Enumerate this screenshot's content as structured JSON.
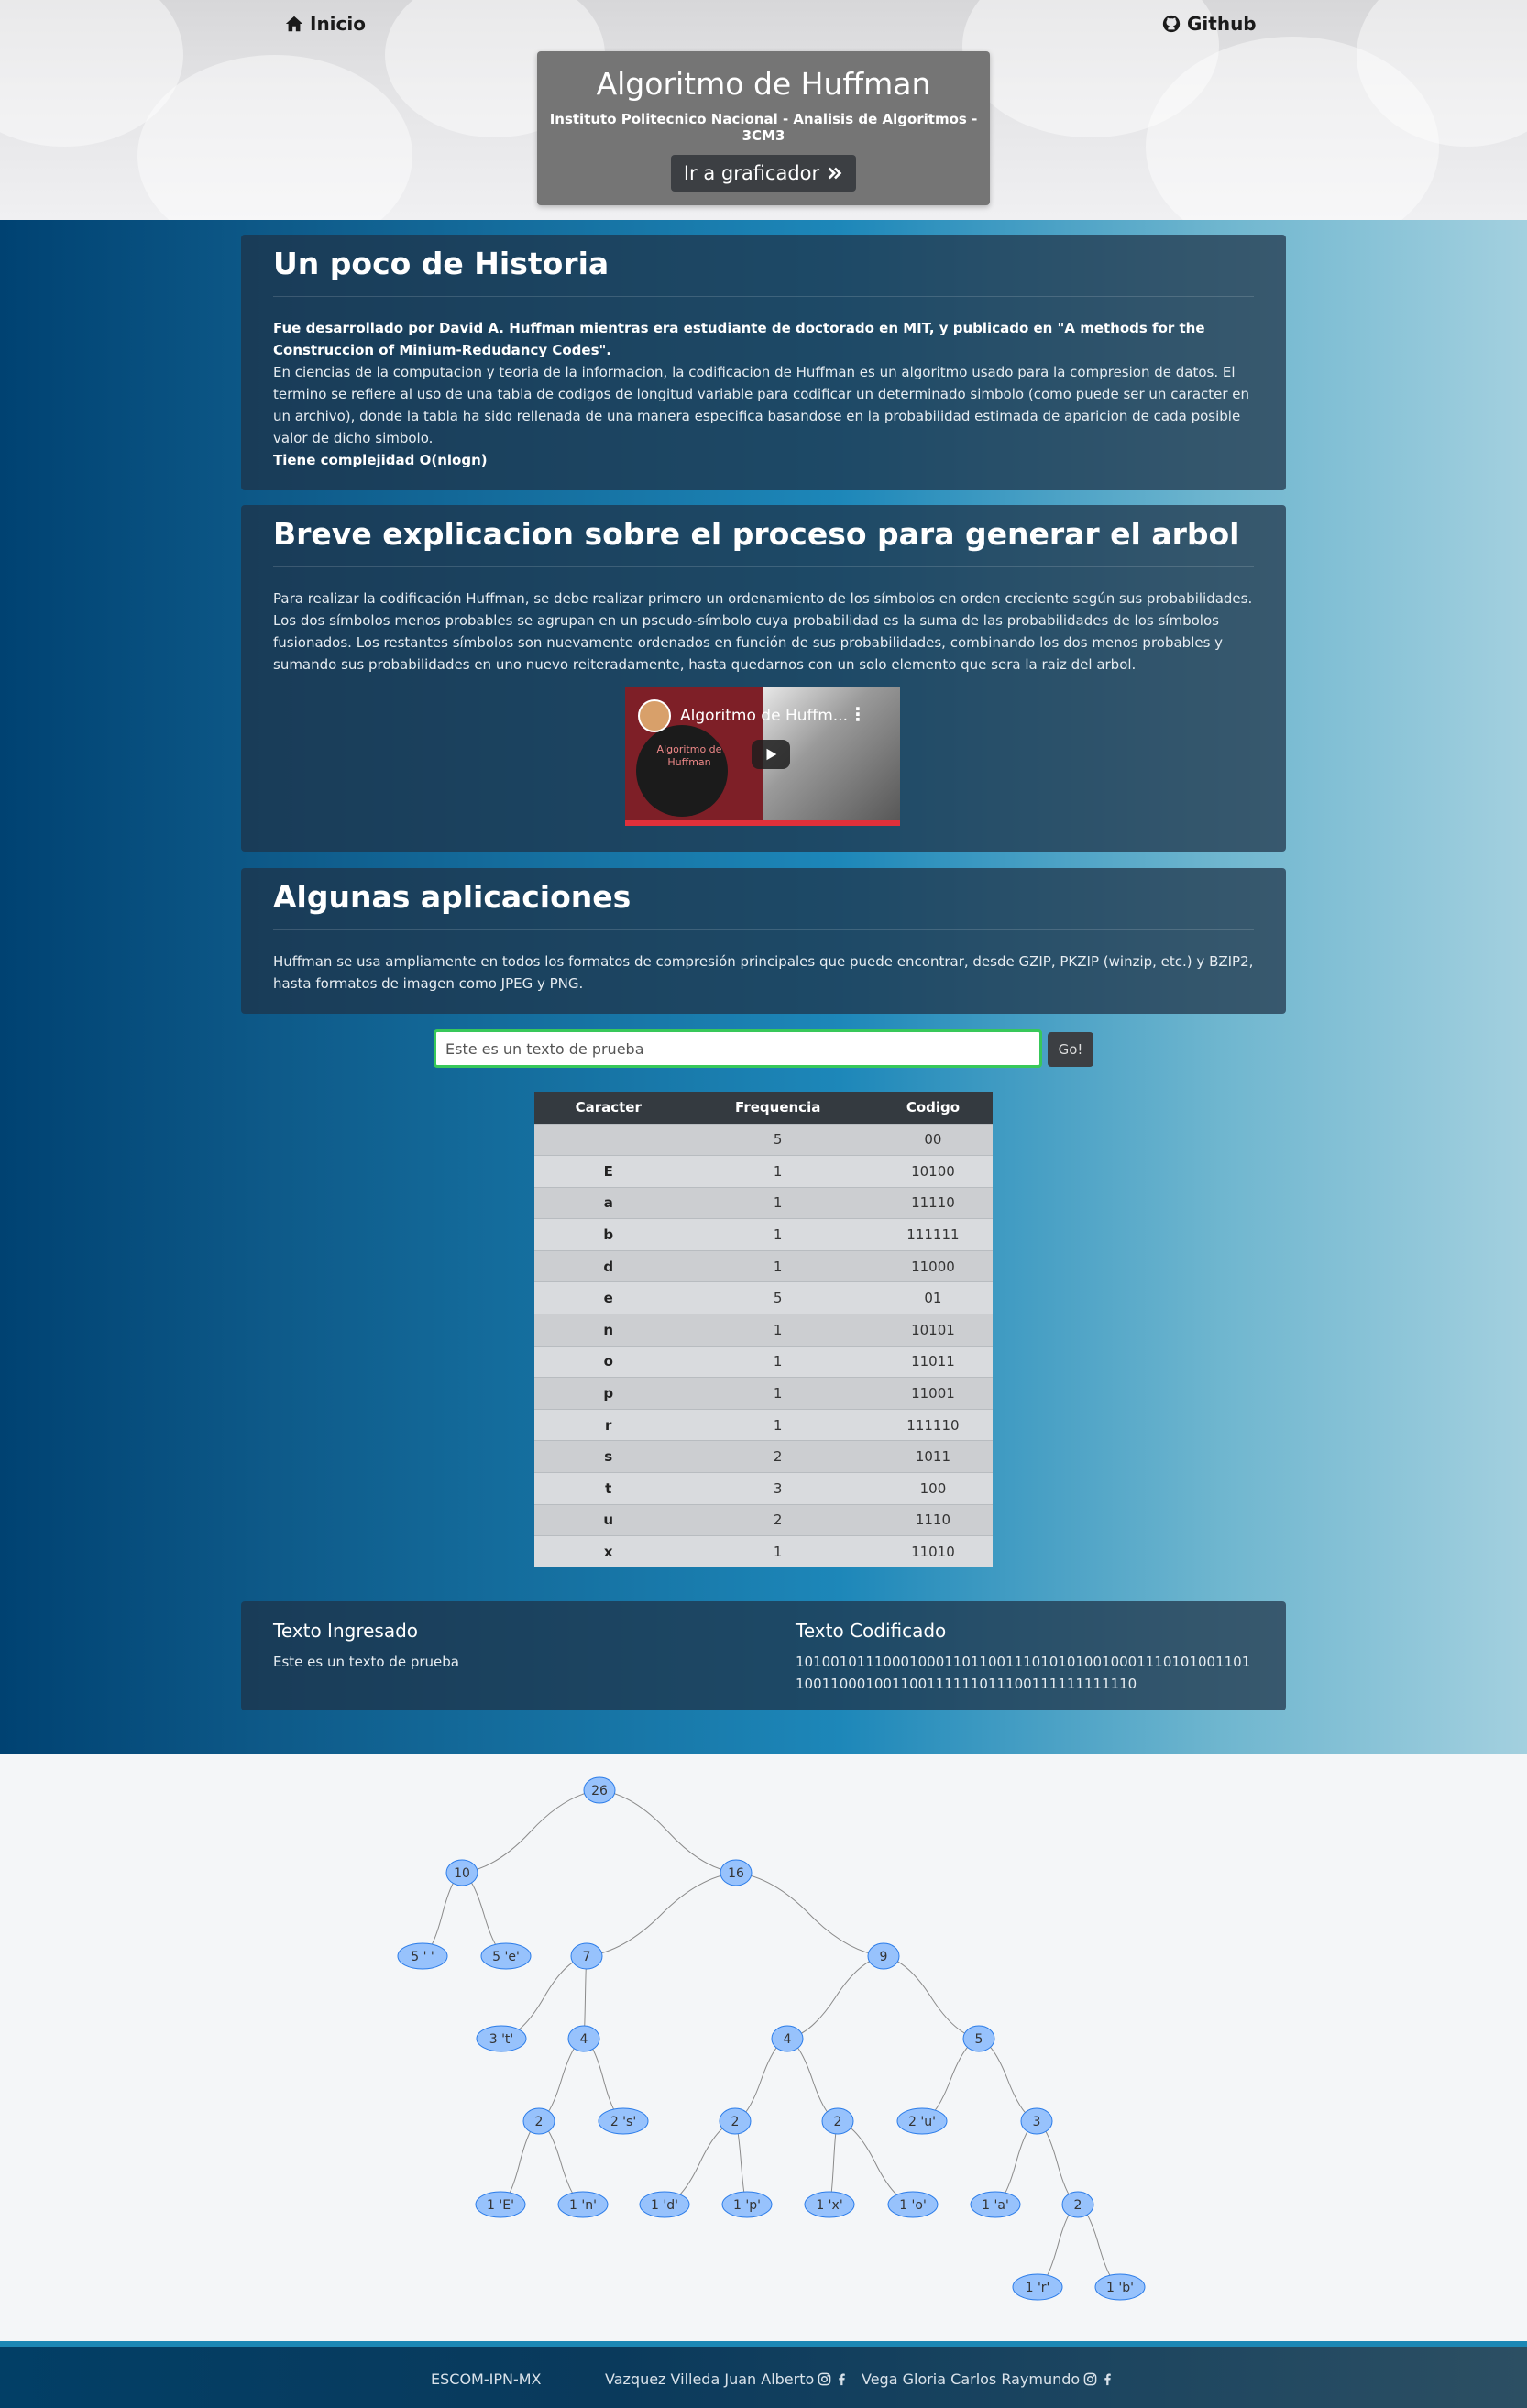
{
  "nav": {
    "home_label": "Inicio",
    "github_label": "Github"
  },
  "hero": {
    "title": "Algoritmo de Huffman",
    "subtitle": "Instituto Politecnico Nacional - Analisis de Algoritmos - 3CM3",
    "button_label": "Ir a graficador"
  },
  "history": {
    "heading": "Un poco de Historia",
    "bold_intro": "Fue desarrollado por David A. Huffman mientras era estudiante de doctorado en MIT, y publicado en \"A methods for the Construccion of Minium-Redudancy Codes\".",
    "body": "En ciencias de la computacion y teoria de la informacion, la codificacion de Huffman es un algoritmo usado para la compresion de datos. El termino se refiere al uso de una tabla de codigos de longitud variable para codificar un determinado simbolo (como puede ser un caracter en un archivo), donde la tabla ha sido rellenada de una manera especifica basandose en la probabilidad estimada de aparicion de cada posible valor de dicho simbolo.",
    "complexity": "Tiene complejidad O(nlogn)"
  },
  "process": {
    "heading": "Breve explicacion sobre el proceso para generar el arbol",
    "body": "Para realizar la codificación Huffman, se debe realizar primero un ordenamiento de los símbolos en orden creciente según sus probabilidades. Los dos símbolos menos probables se agrupan en un pseudo-símbolo cuya probabilidad es la suma de las probabilidades de los símbolos fusionados. Los restantes símbolos son nuevamente ordenados en función de sus probabilidades, combinando los dos menos probables y sumando sus probabilidades en uno nuevo reiteradamente, hasta quedarnos con un solo elemento que sera la raiz del arbol.",
    "video_title": "Algoritmo de Huffm...",
    "video_thumb_text": "Algoritmo de Huffman"
  },
  "applications": {
    "heading": "Algunas aplicaciones",
    "body": "Huffman se usa ampliamente en todos los formatos de compresión principales que puede encontrar, desde GZIP, PKZIP (winzip, etc.) y BZIP2, hasta formatos de imagen como JPEG y PNG."
  },
  "input": {
    "value": "Este es un texto de prueba",
    "go_label": "Go!"
  },
  "table": {
    "headers": [
      "Caracter",
      "Frequencia",
      "Codigo"
    ],
    "rows": [
      [
        " ",
        "5",
        "00"
      ],
      [
        "E",
        "1",
        "10100"
      ],
      [
        "a",
        "1",
        "11110"
      ],
      [
        "b",
        "1",
        "111111"
      ],
      [
        "d",
        "1",
        "11000"
      ],
      [
        "e",
        "5",
        "01"
      ],
      [
        "n",
        "1",
        "10101"
      ],
      [
        "o",
        "1",
        "11011"
      ],
      [
        "p",
        "1",
        "11001"
      ],
      [
        "r",
        "1",
        "111110"
      ],
      [
        "s",
        "2",
        "1011"
      ],
      [
        "t",
        "3",
        "100"
      ],
      [
        "u",
        "2",
        "1110"
      ],
      [
        "x",
        "1",
        "11010"
      ]
    ]
  },
  "result": {
    "input_heading": "Texto Ingresado",
    "input_text": "Este es un texto de prueba",
    "encoded_heading": "Texto Codificado",
    "encoded_text": "1010010111000100011011001110101010010001110101001101100110001001100111111011100111111111110"
  },
  "tree": {
    "nodes": [
      {
        "id": "n26",
        "label": "26"
      },
      {
        "id": "n10",
        "label": "10"
      },
      {
        "id": "n16",
        "label": "16"
      },
      {
        "id": "sp",
        "label": "5 ' '"
      },
      {
        "id": "e",
        "label": "5 'e'"
      },
      {
        "id": "n7",
        "label": "7"
      },
      {
        "id": "n9",
        "label": "9"
      },
      {
        "id": "t",
        "label": "3 't'"
      },
      {
        "id": "n4a",
        "label": "4"
      },
      {
        "id": "n4b",
        "label": "4"
      },
      {
        "id": "n5",
        "label": "5"
      },
      {
        "id": "n2a",
        "label": "2"
      },
      {
        "id": "s",
        "label": "2 's'"
      },
      {
        "id": "n2b",
        "label": "2"
      },
      {
        "id": "n2c",
        "label": "2"
      },
      {
        "id": "u",
        "label": "2 'u'"
      },
      {
        "id": "n3",
        "label": "3"
      },
      {
        "id": "E",
        "label": "1 'E'"
      },
      {
        "id": "n",
        "label": "1 'n'"
      },
      {
        "id": "d",
        "label": "1 'd'"
      },
      {
        "id": "p",
        "label": "1 'p'"
      },
      {
        "id": "x",
        "label": "1 'x'"
      },
      {
        "id": "o",
        "label": "1 'o'"
      },
      {
        "id": "a",
        "label": "1 'a'"
      },
      {
        "id": "n2d",
        "label": "2"
      },
      {
        "id": "r",
        "label": "1 'r'"
      },
      {
        "id": "b",
        "label": "1 'b'"
      }
    ],
    "edges": [
      [
        "n26",
        "n10"
      ],
      [
        "n26",
        "n16"
      ],
      [
        "n10",
        "sp"
      ],
      [
        "n10",
        "e"
      ],
      [
        "n16",
        "n7"
      ],
      [
        "n16",
        "n9"
      ],
      [
        "n7",
        "t"
      ],
      [
        "n7",
        "n4a"
      ],
      [
        "n9",
        "n4b"
      ],
      [
        "n9",
        "n5"
      ],
      [
        "n4a",
        "n2a"
      ],
      [
        "n4a",
        "s"
      ],
      [
        "n4b",
        "n2b"
      ],
      [
        "n4b",
        "n2c"
      ],
      [
        "n5",
        "u"
      ],
      [
        "n5",
        "n3"
      ],
      [
        "n2a",
        "E"
      ],
      [
        "n2a",
        "n"
      ],
      [
        "n2b",
        "d"
      ],
      [
        "n2b",
        "p"
      ],
      [
        "n2c",
        "x"
      ],
      [
        "n2c",
        "o"
      ],
      [
        "n3",
        "a"
      ],
      [
        "n3",
        "n2d"
      ],
      [
        "n2d",
        "r"
      ],
      [
        "n2d",
        "b"
      ]
    ],
    "node_color": "#97c2fc",
    "node_border": "#2b7ce9"
  },
  "footer": {
    "school": "ESCOM-IPN-MX",
    "author1": "Vazquez Villeda Juan Alberto",
    "author2": "Vega Gloria Carlos Raymundo"
  }
}
